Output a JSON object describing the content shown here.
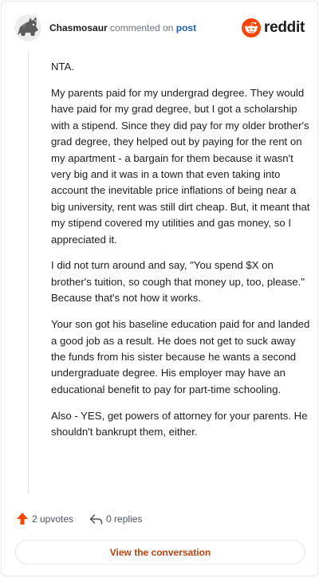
{
  "comment": {
    "author": "Chasmosaur",
    "action_text": " commented on ",
    "post_link": "post",
    "paragraphs": [
      "NTA.",
      "My parents paid for my undergrad degree. They would have paid for my grad degree, but I got a scholarship with a stipend. Since they did pay for my older brother's grad degree, they helped out by paying for the rent on my apartment - a bargain for them because it wasn't very big and it was in a town that even taking into account the inevitable price inflations of being near a big university, rent was still dirt cheap. But, it meant that my stipend covered my utilities and gas money, so I appreciated it.",
      "I did not turn around and say, \"You spend $X on brother's tuition, so cough that money up, too, please.\" Because that's not how it works.",
      "Your son got his baseline education paid for and landed a good job as a result. He does not get to suck away the funds from his sister because he wants a second undergraduate degree. His employer may have an educational benefit to pay for part-time schooling.",
      "Also - YES, get powers of attorney for your parents. He shouldn't bankrupt them, either."
    ]
  },
  "brand": {
    "name": "reddit",
    "color": "#ff4500"
  },
  "footer": {
    "upvotes_label": "2 upvotes",
    "replies_label": "0 replies",
    "view_button": "View the conversation"
  },
  "icons": {
    "avatar": "snoo-avatar",
    "logo": "reddit-logo-icon",
    "upvote": "upvote-arrow-icon",
    "reply": "reply-arrow-icon"
  },
  "colors": {
    "upvote_arrow": "#ff4500",
    "link": "#1a5fb4",
    "button_text": "#c2410c"
  }
}
